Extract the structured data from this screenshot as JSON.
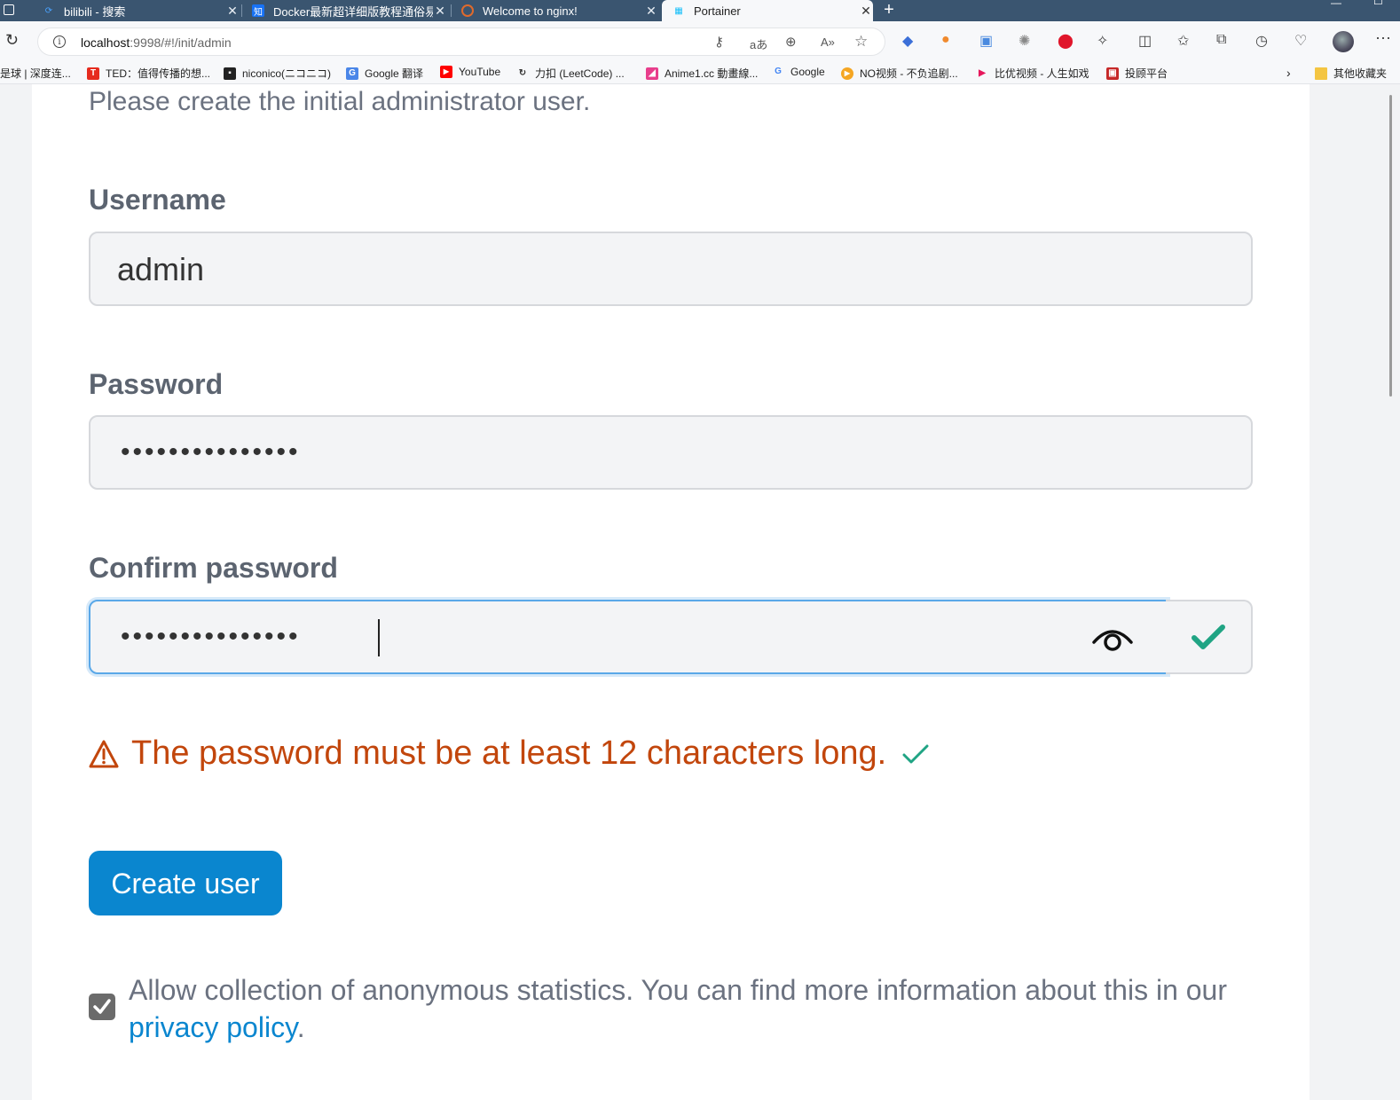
{
  "browser": {
    "tabs": [
      {
        "title": "bilibili - 搜索",
        "icon": "bilibili-icon"
      },
      {
        "title": "Docker最新超详细版教程通俗易懂",
        "icon": "zhihu-icon"
      },
      {
        "title": "Welcome to nginx!",
        "icon": "nginx-icon"
      },
      {
        "title": "Portainer",
        "icon": "portainer-icon",
        "active": true
      }
    ],
    "url_host": "localhost",
    "url_rest": ":9998/#!/init/admin",
    "bookmarks": [
      "是球 | 深度连...",
      "TED：值得传播的想...",
      "niconico(ニコニコ)",
      "Google 翻译",
      "YouTube",
      "力扣 (LeetCode) ...",
      "Anime1.cc 動畫線...",
      "Google",
      "NO视频 - 不负追剧...",
      "比优视频 - 人生如戏",
      "投顾平台"
    ],
    "other_bookmarks": "其他收藏夹"
  },
  "form": {
    "intro": "Please create the initial administrator user.",
    "username_label": "Username",
    "username_value": "admin",
    "password_label": "Password",
    "password_mask": "•••••••••••••••",
    "confirm_label": "Confirm password",
    "confirm_mask": "•••••••••••••••",
    "warning": "The password must be at least 12 characters long.",
    "create_button": "Create user",
    "stats_text": "Allow collection of anonymous statistics. You can find more information about this in our ",
    "privacy_link": "privacy policy",
    "stats_suffix": ".",
    "stats_checked": true
  },
  "colors": {
    "accent": "#0a86cf",
    "warning": "#c2460c",
    "success": "#20a484"
  }
}
